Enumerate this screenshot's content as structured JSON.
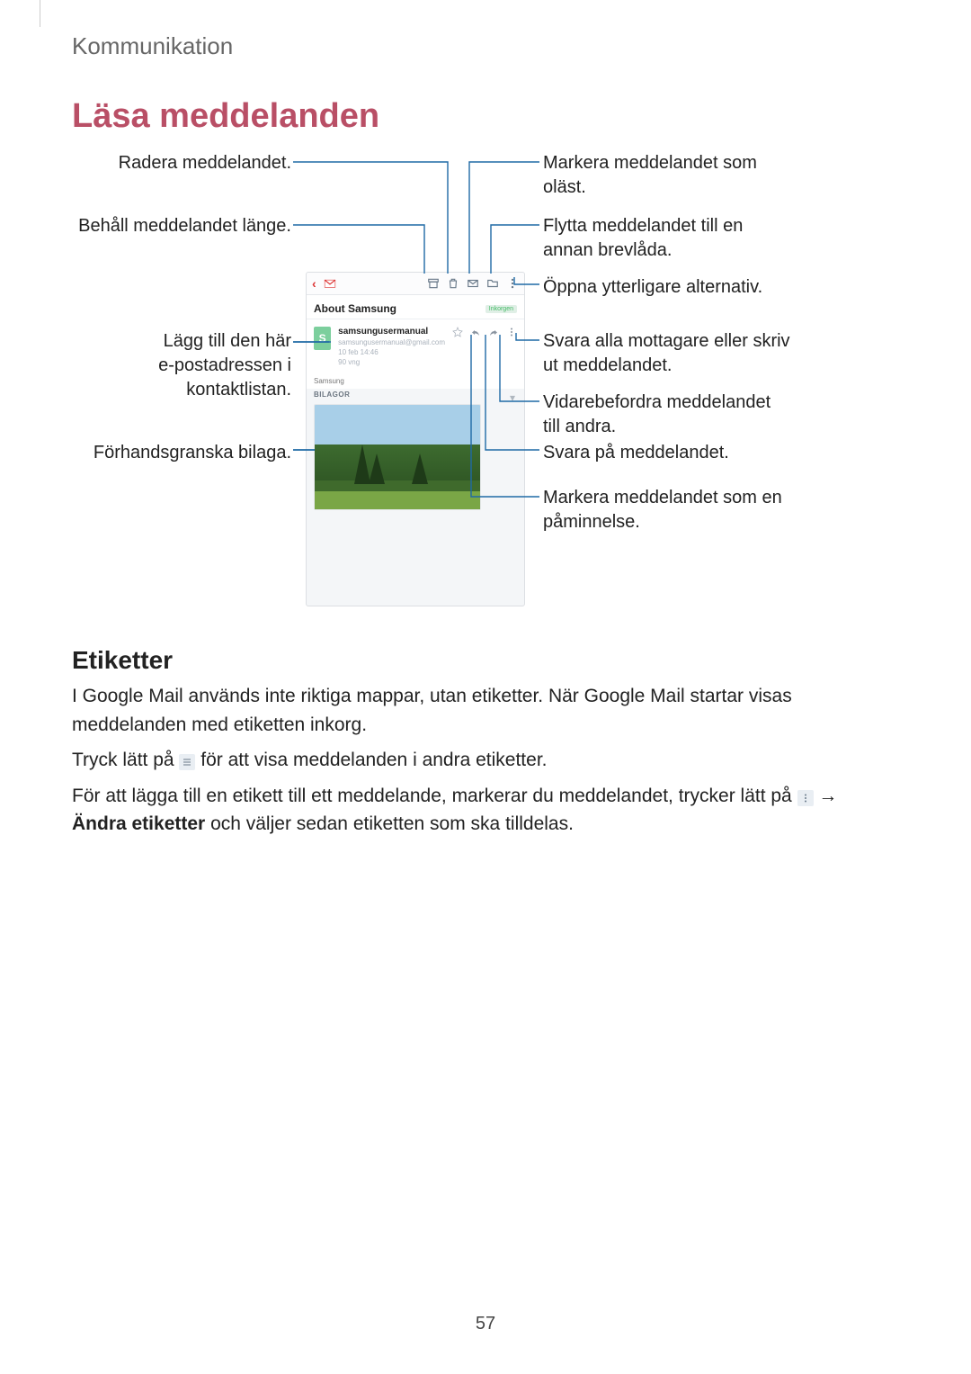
{
  "header": {
    "breadcrumb": "Kommunikation"
  },
  "title": "Läsa meddelanden",
  "left_callouts": {
    "delete": "Radera meddelandet.",
    "keep": "Behåll meddelandet länge.",
    "add_contact_l1": "Lägg till den här",
    "add_contact_l2": "e-postadressen i kontaktlistan.",
    "preview": "Förhandsgranska bilaga."
  },
  "right_callouts": {
    "mark_unread_l1": "Markera meddelandet som",
    "mark_unread_l2": "oläst.",
    "move_l1": "Flytta meddelandet till en",
    "move_l2": "annan brevlåda.",
    "more": "Öppna ytterligare alternativ.",
    "reply_all_l1": "Svara alla mottagare eller skriv",
    "reply_all_l2": "ut meddelandet.",
    "forward_l1": "Vidarebefordra meddelandet",
    "forward_l2": "till andra.",
    "reply": "Svara på meddelandet.",
    "remind_l1": "Markera meddelandet som en",
    "remind_l2": "påminnelse."
  },
  "phone": {
    "subject": "About Samsung",
    "label": "Inkorgen",
    "avatar_letter": "S",
    "sender_name": "samsungusermanual",
    "sender_email": "samsungusermanual@gmail.com",
    "date": "10 feb 14:46",
    "size": "90 vng",
    "body": "Samsung",
    "attachments_header": "BILAGOR"
  },
  "section": {
    "heading": "Etiketter",
    "p1": "I Google Mail används inte riktiga mappar, utan etiketter. När Google Mail startar visas meddelanden med etiketten inkorg.",
    "p2a": "Tryck lätt på ",
    "p2b": " för att visa meddelanden i andra etiketter.",
    "p3a": "För att lägga till en etikett till ett meddelande, markerar du meddelandet, trycker lätt på ",
    "p3arrow": " → ",
    "p3b": "Ändra etiketter",
    "p3c": " och väljer sedan etiketten som ska tilldelas."
  },
  "page_number": "57"
}
